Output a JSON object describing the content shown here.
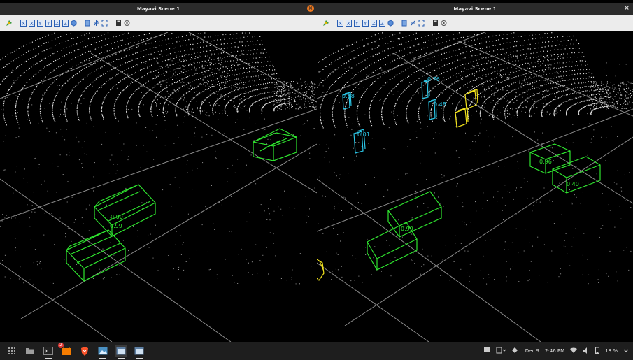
{
  "windows": [
    {
      "title": "Mayavi Scene 1"
    },
    {
      "title": "Mayavi Scene 1"
    }
  ],
  "toolbar_icons": [
    "mayavi-logo-icon",
    "view-x-plus-icon",
    "view-x-minus-icon",
    "view-y-plus-icon",
    "view-y-minus-icon",
    "view-z-plus-icon",
    "view-z-minus-icon",
    "isometric-view-icon",
    "parallel-projection-icon",
    "axes-toggle-icon",
    "fullscreen-icon",
    "save-icon",
    "settings-icon"
  ],
  "left_labels": [
    "0.00",
    "0.99"
  ],
  "right_labels": {
    "cyan": [
      "0.58",
      "0.76",
      "0.48",
      "0.01"
    ],
    "green": [
      "0.99",
      "0.96",
      "0.40"
    ]
  },
  "taskbar": {
    "notification_count": "2",
    "date": "Dec 9",
    "time": "2:46 PM",
    "battery": "18 %"
  },
  "colors": {
    "green_box": "#2fe52f",
    "cyan_box": "#2bc7e8",
    "yellow_box": "#f2e31b",
    "points": "#d9d9d9"
  }
}
